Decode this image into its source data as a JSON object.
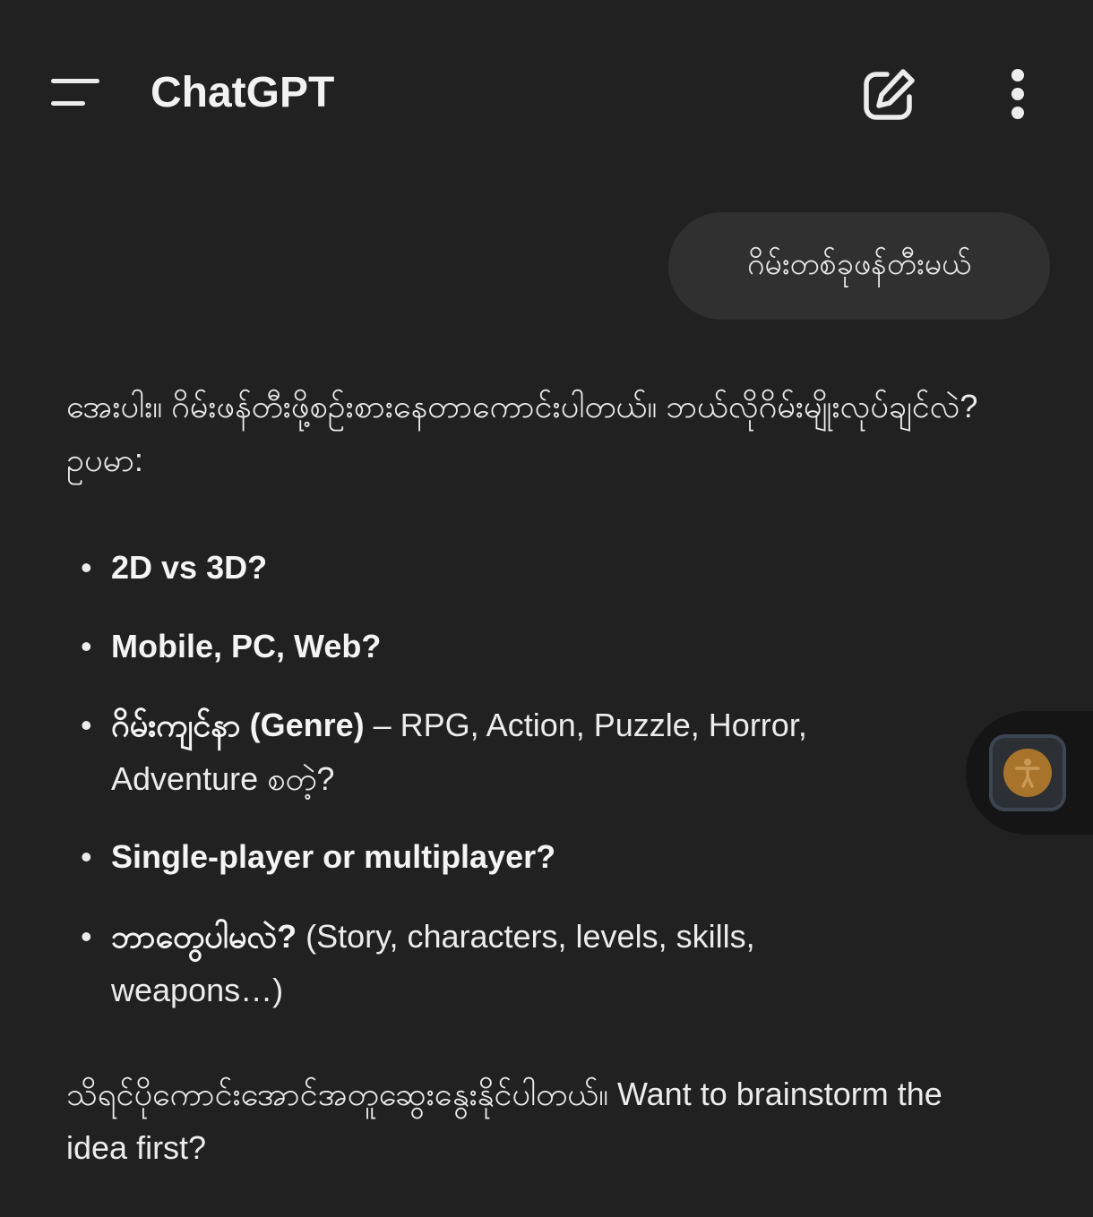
{
  "header": {
    "title": "ChatGPT",
    "menu_icon": "hamburger-menu-icon",
    "new_chat_icon": "edit-pencil-icon",
    "more_icon": "vertical-dots-icon"
  },
  "user_message": "ဂိမ်းတစ်ခုဖန်တီးမယ်",
  "assistant": {
    "intro": "အေးပါး။ ဂိမ်းဖန်တီးဖို့စဉ်းစားနေတာကောင်းပါတယ်။ ဘယ်လိုဂိမ်းမျိုးလုပ်ချင်လဲ? ဥပမာ:",
    "items": [
      {
        "bold": "2D vs 3D?",
        "rest": ""
      },
      {
        "bold": "Mobile, PC, Web?",
        "rest": ""
      },
      {
        "bold": "ဂိမ်းကျင်နာ (Genre)",
        "rest": " – RPG, Action, Puzzle, Horror, Adventure စတဲ့?"
      },
      {
        "bold": "Single-player or multiplayer?",
        "rest": ""
      },
      {
        "bold": "ဘာတွေပါမလဲ?",
        "rest": " (Story, characters, levels, skills, weapons…)"
      }
    ],
    "closing": "သိရင်ပိုကောင်းအောင်အတူဆွေးနွေးနိုင်ပါတယ်။ Want to brainstorm the idea first?"
  },
  "floating_widget": {
    "icon": "accessibility-icon",
    "accent_color": "#a8742c"
  },
  "colors": {
    "background": "#212121",
    "bubble": "#303030",
    "text": "#ececec"
  }
}
